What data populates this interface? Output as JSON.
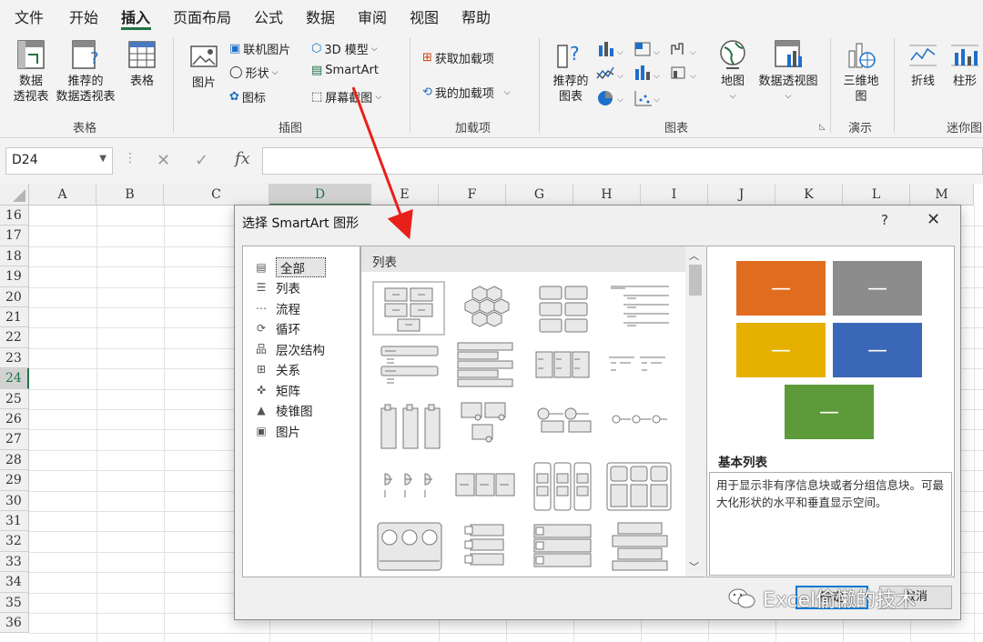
{
  "tabs": [
    "文件",
    "开始",
    "插入",
    "页面布局",
    "公式",
    "数据",
    "审阅",
    "视图",
    "帮助"
  ],
  "ribbon": {
    "pivot_table": "数据\n透视表",
    "recommended_pivot": "推荐的\n数据透视表",
    "table": "表格",
    "group_tables": "表格",
    "picture": "图片",
    "online_picture": "联机图片",
    "shapes": "形状",
    "icons": "图标",
    "model3d": "3D 模型",
    "smartart": "SmartArt",
    "screenshot": "屏幕截图",
    "group_illustrations": "插图",
    "get_addins": "获取加载项",
    "my_addins": "我的加载项",
    "group_addins": "加载项",
    "recommended_charts": "推荐的\n图表",
    "maps": "地图",
    "pivot_chart": "数据透视图",
    "group_charts": "图表",
    "map3d": "三维地\n图",
    "group_tours": "演示",
    "line": "折线",
    "column": "柱形",
    "group_sparklines": "迷你图"
  },
  "formula_bar": {
    "name_box": "D24",
    "fx": "fx",
    "formula": ""
  },
  "grid": {
    "columns": [
      "A",
      "B",
      "C",
      "D",
      "E",
      "F",
      "G",
      "H",
      "I",
      "J",
      "K",
      "L",
      "M"
    ],
    "rows": [
      "16",
      "17",
      "18",
      "19",
      "20",
      "21",
      "22",
      "23",
      "24",
      "25",
      "26",
      "27",
      "28",
      "29",
      "30",
      "31",
      "32",
      "33",
      "34",
      "35",
      "36"
    ],
    "selected_column": "D",
    "selected_row": "24"
  },
  "dialog": {
    "title": "选择 SmartArt 图形",
    "help": "?",
    "close": "✕",
    "categories": [
      {
        "label": "全部",
        "icon": "all-icon"
      },
      {
        "label": "列表",
        "icon": "list-icon"
      },
      {
        "label": "流程",
        "icon": "process-icon"
      },
      {
        "label": "循环",
        "icon": "cycle-icon"
      },
      {
        "label": "层次结构",
        "icon": "hierarchy-icon"
      },
      {
        "label": "关系",
        "icon": "relationship-icon"
      },
      {
        "label": "矩阵",
        "icon": "matrix-icon"
      },
      {
        "label": "棱锥图",
        "icon": "pyramid-icon"
      },
      {
        "label": "图片",
        "icon": "picture-icon"
      }
    ],
    "layouts_header": "列表",
    "preview_name": "基本列表",
    "preview_desc": "用于显示非有序信息块或者分组信息块。可最大化形状的水平和垂直显示空间。",
    "ok": "确定",
    "cancel": "取消",
    "preview_colors": [
      "#e06c1f",
      "#8c8c8c",
      "#e6b000",
      "#3a67b8",
      "#5c9a3a"
    ]
  },
  "watermark": "Excel偷懒的技术"
}
